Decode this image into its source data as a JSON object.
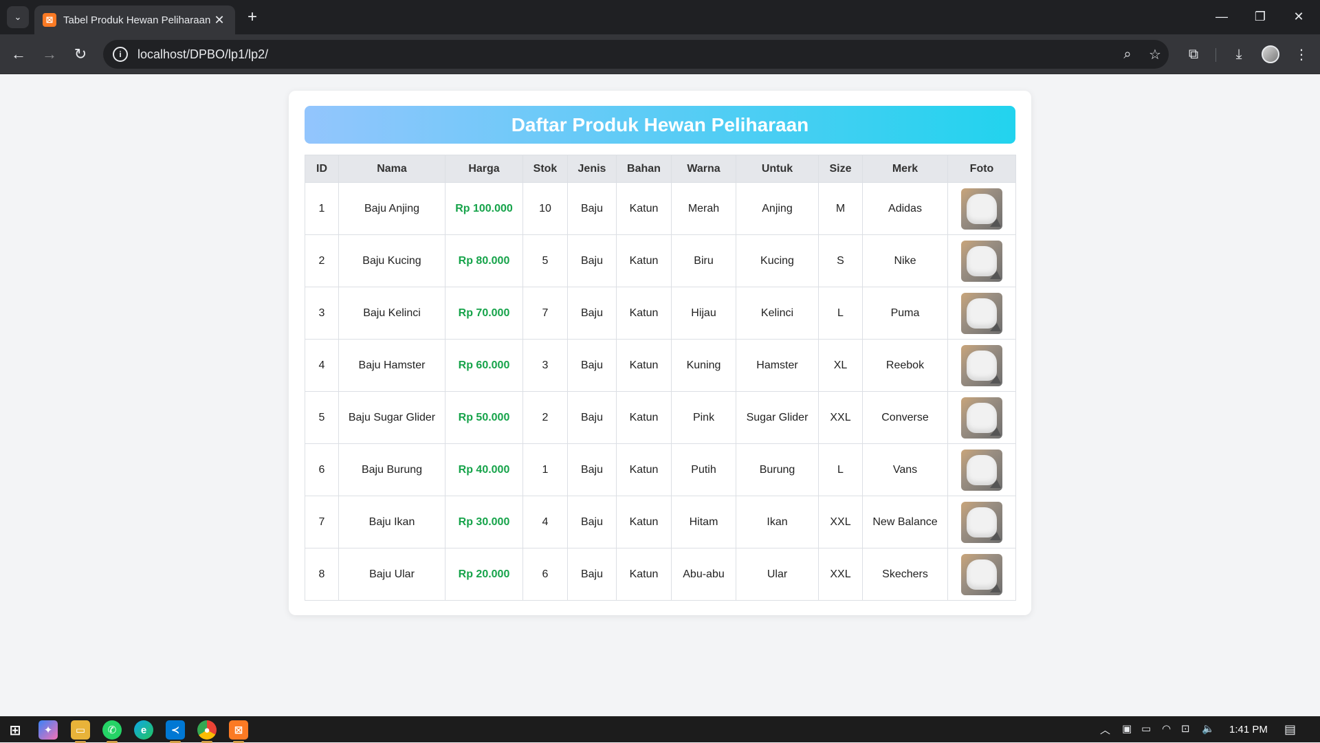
{
  "browser": {
    "tab_title": "Tabel Produk Hewan Peliharaan",
    "favicon_letter": "⊠",
    "url": "localhost/DPBO/lp1/lp2/",
    "icons": [
      "tab-search-icon",
      "back-arrow-icon",
      "forward-arrow-icon",
      "reload-icon",
      "site-info-icon",
      "zoom-icon",
      "bookmark-star-icon",
      "extensions-icon",
      "download-icon",
      "profile-avatar-icon",
      "menu-kebab-icon",
      "minimize-icon",
      "restore-icon",
      "close-window-icon"
    ]
  },
  "page": {
    "title": "Daftar Produk Hewan Peliharaan",
    "accent_green": "#16a34a",
    "banner_gradient": [
      "#93c5fd",
      "#22d3ee"
    ]
  },
  "table": {
    "headers": [
      "ID",
      "Nama",
      "Harga",
      "Stok",
      "Jenis",
      "Bahan",
      "Warna",
      "Untuk",
      "Size",
      "Merk",
      "Foto"
    ],
    "rows": [
      {
        "id": "1",
        "nama": "Baju Anjing",
        "harga": "Rp 100.000",
        "stok": "10",
        "jenis": "Baju",
        "bahan": "Katun",
        "warna": "Merah",
        "untuk": "Anjing",
        "size": "M",
        "merk": "Adidas"
      },
      {
        "id": "2",
        "nama": "Baju Kucing",
        "harga": "Rp 80.000",
        "stok": "5",
        "jenis": "Baju",
        "bahan": "Katun",
        "warna": "Biru",
        "untuk": "Kucing",
        "size": "S",
        "merk": "Nike"
      },
      {
        "id": "3",
        "nama": "Baju Kelinci",
        "harga": "Rp 70.000",
        "stok": "7",
        "jenis": "Baju",
        "bahan": "Katun",
        "warna": "Hijau",
        "untuk": "Kelinci",
        "size": "L",
        "merk": "Puma"
      },
      {
        "id": "4",
        "nama": "Baju Hamster",
        "harga": "Rp 60.000",
        "stok": "3",
        "jenis": "Baju",
        "bahan": "Katun",
        "warna": "Kuning",
        "untuk": "Hamster",
        "size": "XL",
        "merk": "Reebok"
      },
      {
        "id": "5",
        "nama": "Baju Sugar Glider",
        "harga": "Rp 50.000",
        "stok": "2",
        "jenis": "Baju",
        "bahan": "Katun",
        "warna": "Pink",
        "untuk": "Sugar Glider",
        "size": "XXL",
        "merk": "Converse"
      },
      {
        "id": "6",
        "nama": "Baju Burung",
        "harga": "Rp 40.000",
        "stok": "1",
        "jenis": "Baju",
        "bahan": "Katun",
        "warna": "Putih",
        "untuk": "Burung",
        "size": "L",
        "merk": "Vans"
      },
      {
        "id": "7",
        "nama": "Baju Ikan",
        "harga": "Rp 30.000",
        "stok": "4",
        "jenis": "Baju",
        "bahan": "Katun",
        "warna": "Hitam",
        "untuk": "Ikan",
        "size": "XXL",
        "merk": "New Balance"
      },
      {
        "id": "8",
        "nama": "Baju Ular",
        "harga": "Rp 20.000",
        "stok": "6",
        "jenis": "Baju",
        "bahan": "Katun",
        "warna": "Abu-abu",
        "untuk": "Ular",
        "size": "XXL",
        "merk": "Skechers"
      }
    ]
  },
  "taskbar": {
    "clock": "1:41 PM",
    "apps": [
      "windows-start-icon",
      "copilot-icon",
      "file-explorer-icon",
      "whatsapp-icon",
      "edge-icon",
      "vscode-icon",
      "chrome-icon",
      "xampp-icon"
    ],
    "tray_icons": [
      "chevron-up-icon",
      "meet-now-icon",
      "battery-icon",
      "wifi-icon",
      "network-icon",
      "volume-icon",
      "notifications-icon"
    ]
  }
}
